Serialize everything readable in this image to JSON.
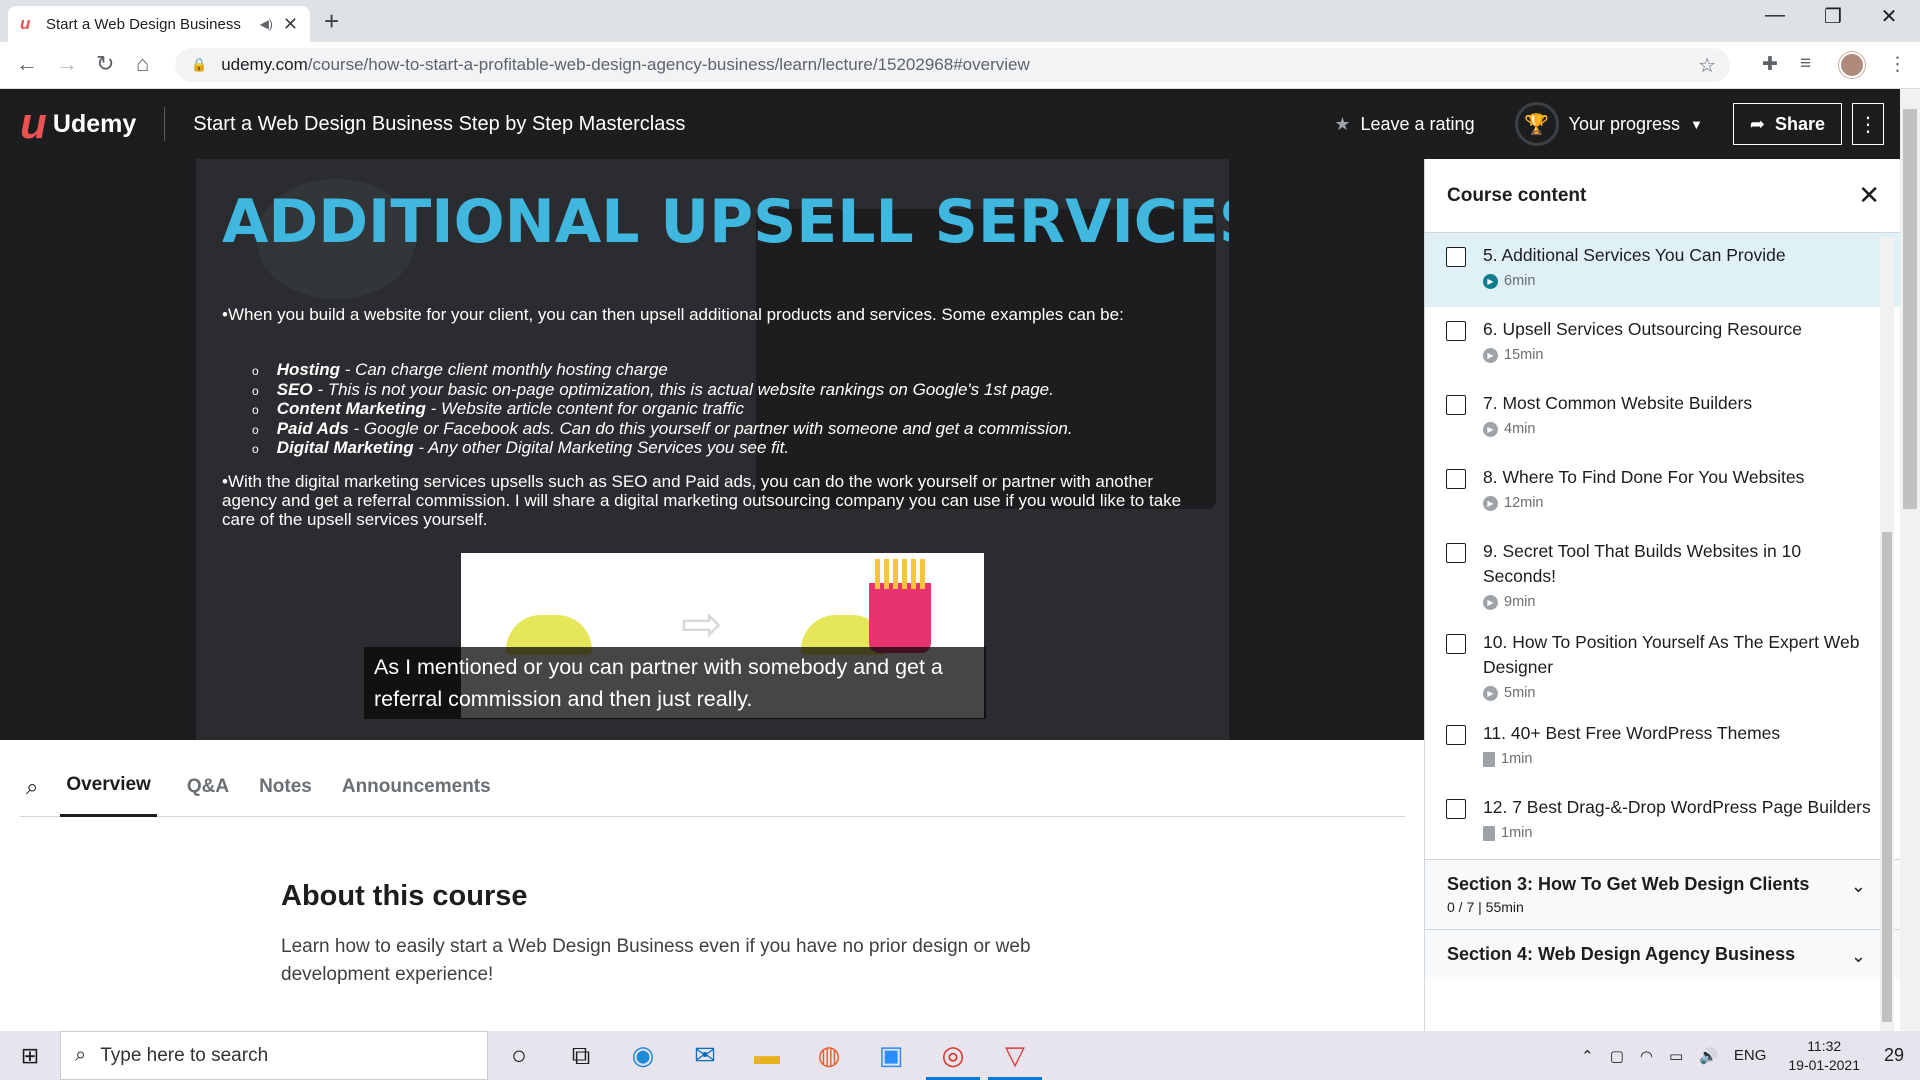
{
  "browser": {
    "tab_title": "Start a Web Design Business",
    "url_domain": "udemy.com",
    "url_path": "/course/how-to-start-a-profitable-web-design-agency-business/learn/lecture/15202968#overview"
  },
  "header": {
    "brand": "Udemy",
    "course_title": "Start a Web Design Business Step by Step Masterclass",
    "rating_label": "Leave a rating",
    "progress_label": "Your progress",
    "share_label": "Share"
  },
  "video": {
    "slide_title": "ADDITIONAL UPSELL SERVICES",
    "paragraph1": "•When you build a website for your client, you can then upsell additional products and services. Some examples can be:",
    "bullets": [
      {
        "term": "Hosting",
        "desc": " - Can charge client monthly hosting charge"
      },
      {
        "term": "SEO",
        "desc": " - This is not your basic on-page optimization, this is actual website rankings on Google's 1st page."
      },
      {
        "term": "Content Marketing",
        "desc": " - Website article content for organic traffic"
      },
      {
        "term": "Paid Ads",
        "desc": " - Google or Facebook ads. Can do this yourself or partner with someone and get a commission."
      },
      {
        "term": "Digital Marketing",
        "desc": " - Any other Digital Marketing Services you see fit."
      }
    ],
    "paragraph2": "•With the digital marketing services upsells such as SEO and Paid ads, you can do the work yourself or partner with another agency and get a referral commission. I will share a digital marketing outsourcing company you can use if you would like to take care of the upsell services yourself.",
    "caption": "As I mentioned or you can partner with somebody and get a referral commission and then just really."
  },
  "tabs": [
    "Overview",
    "Q&A",
    "Notes",
    "Announcements"
  ],
  "about": {
    "heading": "About this course",
    "text": "Learn how to easily start a Web Design Business even if you have no prior design or web development experience!"
  },
  "sidebar": {
    "title": "Course content",
    "lectures": [
      {
        "title": "5. Additional Services You Can Provide",
        "duration": "6min",
        "type": "video"
      },
      {
        "title": "6. Upsell Services Outsourcing Resource",
        "duration": "15min",
        "type": "video"
      },
      {
        "title": "7. Most Common Website Builders",
        "duration": "4min",
        "type": "video"
      },
      {
        "title": "8. Where To Find Done For You Websites",
        "duration": "12min",
        "type": "video"
      },
      {
        "title": "9. Secret Tool That Builds Websites in 10 Seconds!",
        "duration": "9min",
        "type": "video"
      },
      {
        "title": "10. How To Position Yourself As The Expert Web Designer",
        "duration": "5min",
        "type": "video"
      },
      {
        "title": "11. 40+ Best Free WordPress Themes",
        "duration": "1min",
        "type": "doc"
      },
      {
        "title": "12. 7 Best Drag-&-Drop WordPress Page Builders",
        "duration": "1min",
        "type": "doc"
      }
    ],
    "sections": [
      {
        "title": "Section 3: How To Get Web Design Clients",
        "stats": "0 / 7 | 55min"
      },
      {
        "title": "Section 4: Web Design Agency Business",
        "stats": ""
      }
    ]
  },
  "taskbar": {
    "search_placeholder": "Type here to search",
    "lang": "ENG",
    "time": "11:32",
    "date": "19-01-2021",
    "notifications": "29"
  }
}
